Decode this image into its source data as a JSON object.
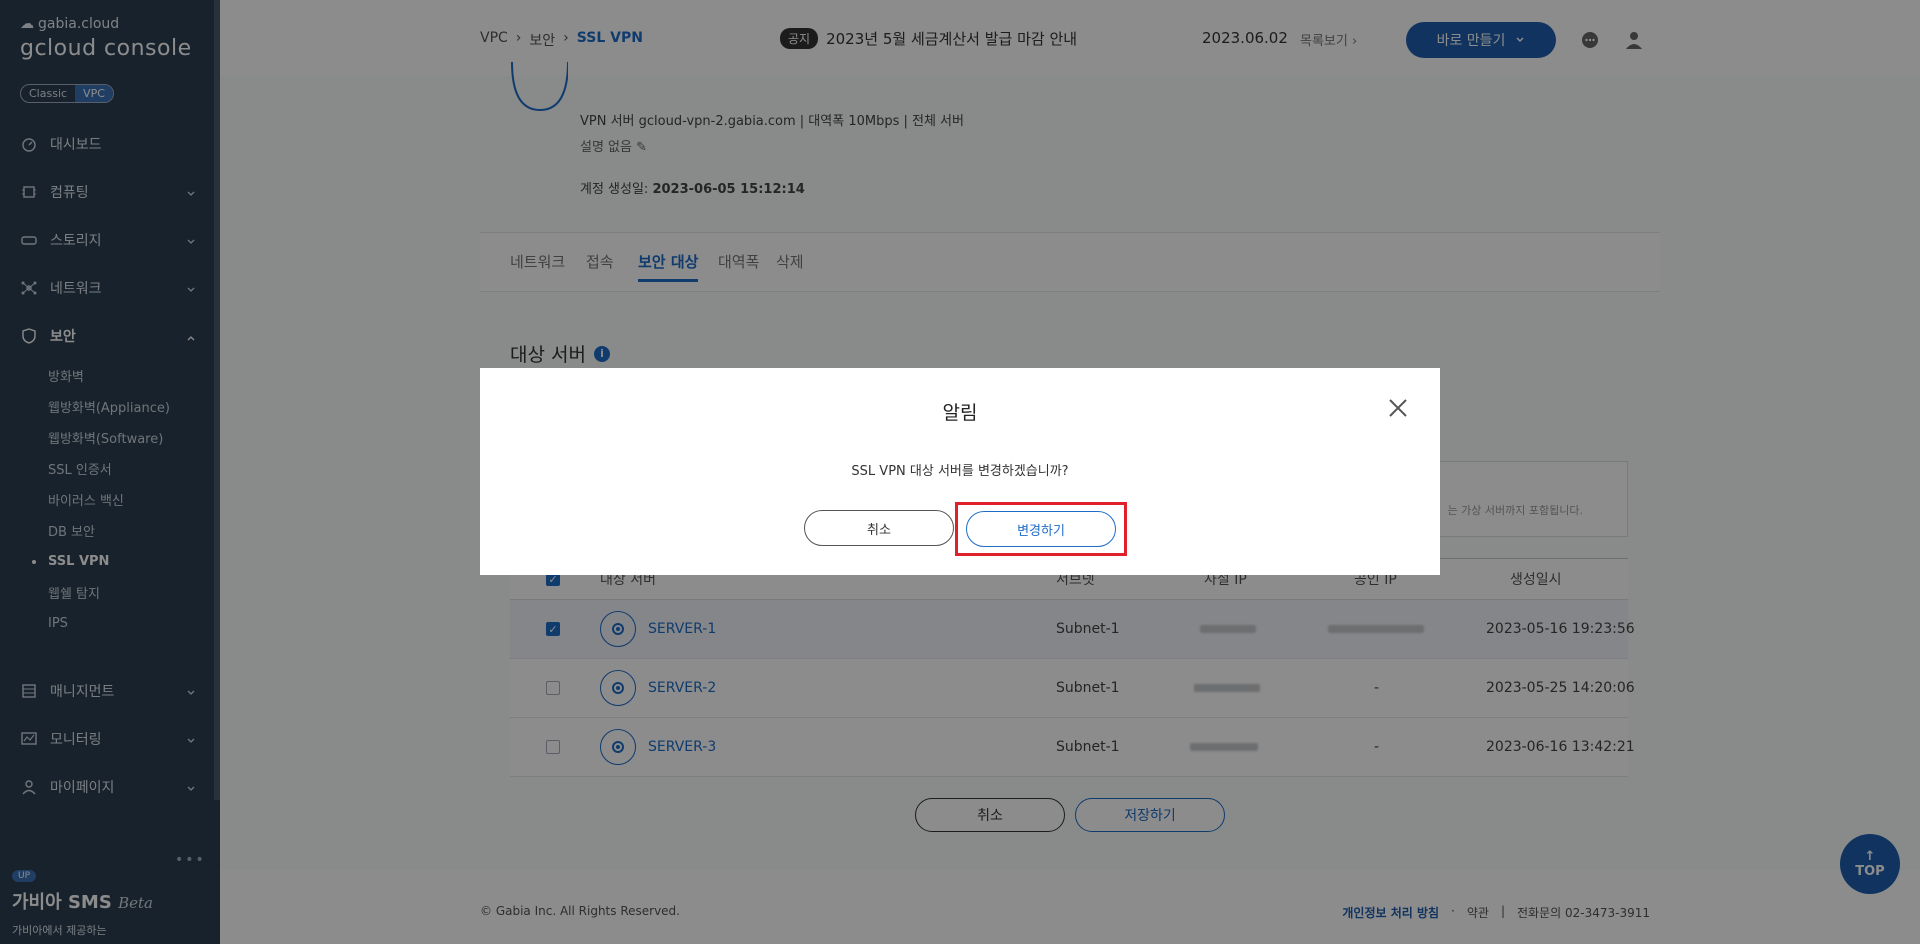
{
  "sidebar": {
    "brand_small": "gabia.cloud",
    "brand_big": "gcloud console",
    "toggle": [
      "Classic",
      "VPC"
    ],
    "items": [
      {
        "label": "대시보드",
        "icon": "dashboard-icon"
      },
      {
        "label": "컴퓨팅",
        "icon": "chip-icon"
      },
      {
        "label": "스토리지",
        "icon": "storage-icon"
      },
      {
        "label": "네트워크",
        "icon": "network-icon"
      },
      {
        "label": "보안",
        "icon": "shield-icon"
      }
    ],
    "security_sub": [
      "방화벽",
      "웹방화벽(Appliance)",
      "웹방화벽(Software)",
      "SSL 인증서",
      "바이러스 백신",
      "DB 보안",
      "SSL VPN",
      "웹쉘 탐지",
      "IPS"
    ],
    "items_bottom": [
      {
        "label": "매니지먼트",
        "icon": "management-icon"
      },
      {
        "label": "모니터링",
        "icon": "monitor-icon"
      },
      {
        "label": "마이페이지",
        "icon": "user-icon"
      }
    ],
    "promo_badge": "UP",
    "promo_title": "가비아 SMS",
    "promo_beta": "Beta",
    "promo_sub": "가비아에서 제공하는"
  },
  "header": {
    "breadcrumb": [
      "VPC",
      "보안",
      "SSL VPN"
    ],
    "notice_tag": "공지",
    "notice_text": "2023년 5월 세금계산서 발급 마감 안내",
    "notice_date": "2023.06.02",
    "notice_list": "목록보기",
    "make_button": "바로 만들기"
  },
  "profile": {
    "line1": "VPN 서버 gcloud-vpn-2.gabia.com   |  대역폭 10Mbps   |   전체 서버",
    "line2": "설명 없음",
    "created_label": "계정 생성일: ",
    "created_value": "2023-06-05 15:12:14"
  },
  "tabs": [
    "네트워크",
    "접속",
    "보안 대상",
    "대역폭",
    "삭제"
  ],
  "section": {
    "title": "대상 서버",
    "info_text": "는 가상 서버까지 포함됩니다."
  },
  "table": {
    "headers": [
      "대상 서버",
      "서브넷",
      "사설 IP",
      "공인 IP",
      "생성일시"
    ],
    "rows": [
      {
        "name": "SERVER-1",
        "subnet": "Subnet-1",
        "public_ip": "",
        "created": "2023-05-16 19:23:56",
        "checked": true
      },
      {
        "name": "SERVER-2",
        "subnet": "Subnet-1",
        "public_ip": "-",
        "created": "2023-05-25 14:20:06",
        "checked": false
      },
      {
        "name": "SERVER-3",
        "subnet": "Subnet-1",
        "public_ip": "-",
        "created": "2023-06-16 13:42:21",
        "checked": false
      }
    ]
  },
  "actions": {
    "cancel": "취소",
    "save": "저장하기"
  },
  "footer": {
    "copyright": "© Gabia Inc. All Rights Reserved.",
    "privacy": "개인정보 처리 방침",
    "terms": "약관",
    "phone": "전화문의  02-3473-3911"
  },
  "top_button": "TOP",
  "modal": {
    "title": "알림",
    "message": "SSL VPN 대상 서버를 변경하겠습니까?",
    "cancel": "취소",
    "confirm": "변경하기"
  },
  "colors": {
    "accent": "#1e6cc7",
    "sidebar": "#2c3e50",
    "highlight": "#e0202a"
  }
}
